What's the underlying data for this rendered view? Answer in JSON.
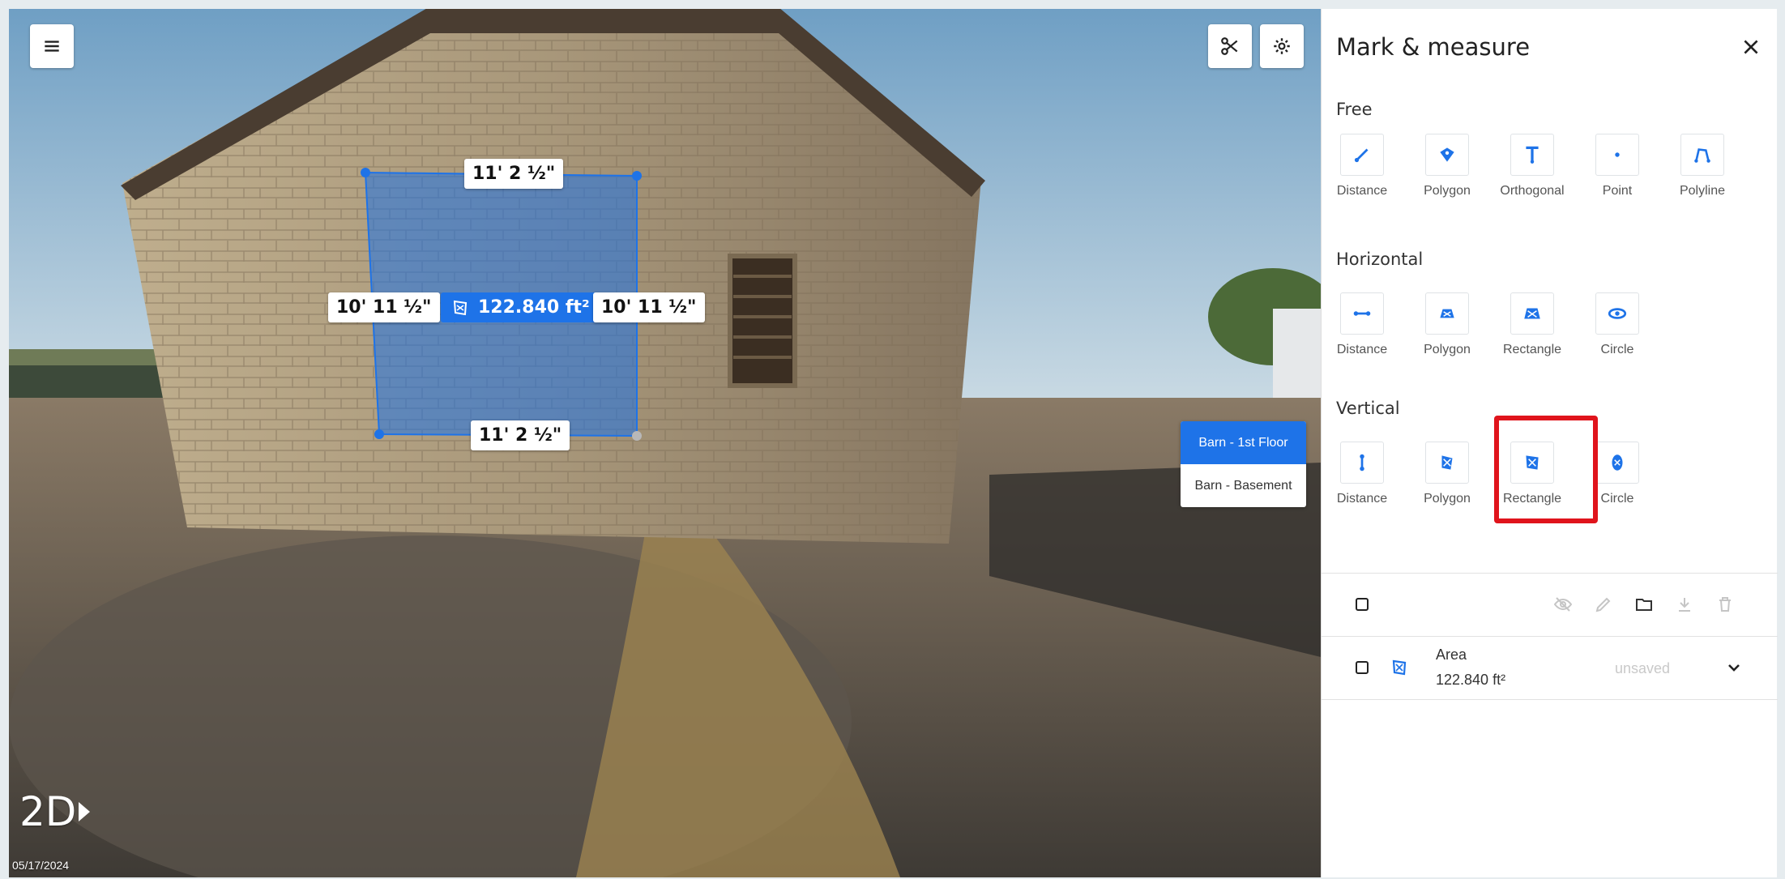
{
  "viewer": {
    "mode_label": "2D",
    "capture_date": "05/17/2024",
    "measurements": {
      "top": "11' 2 ½\"",
      "bottom": "11' 2 ½\"",
      "left": "10' 11 ½\"",
      "right": "10' 11 ½\"",
      "area": "122.840 ft²"
    },
    "floors": [
      {
        "label": "Barn - 1st Floor",
        "active": true
      },
      {
        "label": "Barn - Basement",
        "active": false
      }
    ],
    "icons": {
      "menu": "menu-icon",
      "scissors": "scissors-icon",
      "settings": "gear-icon",
      "play": "play-icon"
    }
  },
  "panel": {
    "title": "Mark & measure",
    "sections": [
      {
        "title": "Free",
        "tools": [
          {
            "label": "Distance",
            "icon": "line-distance-icon"
          },
          {
            "label": "Polygon",
            "icon": "polygon-icon"
          },
          {
            "label": "Orthogonal",
            "icon": "orthogonal-icon"
          },
          {
            "label": "Point",
            "icon": "point-icon"
          },
          {
            "label": "Polyline",
            "icon": "polyline-icon"
          }
        ]
      },
      {
        "title": "Horizontal",
        "tools": [
          {
            "label": "Distance",
            "icon": "horizontal-distance-icon"
          },
          {
            "label": "Polygon",
            "icon": "horizontal-polygon-icon"
          },
          {
            "label": "Rectangle",
            "icon": "horizontal-rectangle-icon"
          },
          {
            "label": "Circle",
            "icon": "horizontal-circle-icon"
          }
        ]
      },
      {
        "title": "Vertical",
        "tools": [
          {
            "label": "Distance",
            "icon": "vertical-distance-icon"
          },
          {
            "label": "Polygon",
            "icon": "vertical-polygon-icon"
          },
          {
            "label": "Rectangle",
            "icon": "vertical-rectangle-icon",
            "highlighted": true
          },
          {
            "label": "Circle",
            "icon": "vertical-circle-icon"
          }
        ]
      }
    ],
    "toolbar_icons": [
      "eye-off-icon",
      "pencil-icon",
      "folder-icon",
      "download-icon",
      "trash-icon"
    ],
    "list": [
      {
        "title": "Area",
        "value": "122.840 ft²",
        "status": "unsaved",
        "icon": "vertical-rectangle-icon"
      }
    ],
    "accent_color": "#1e73e8",
    "highlight_color": "#e0141c"
  }
}
